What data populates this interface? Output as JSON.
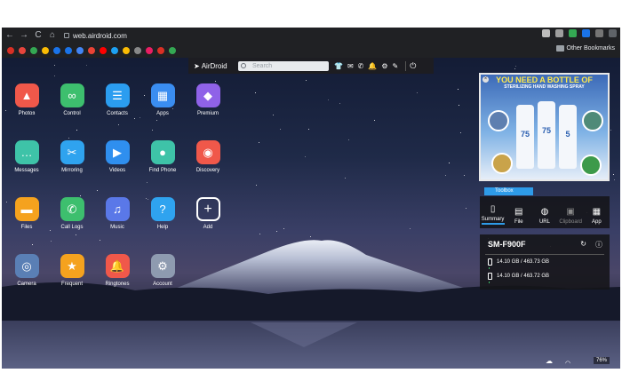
{
  "browser": {
    "url": "web.airdroid.com",
    "other_bookmarks": "Other Bookmarks",
    "nav": {
      "back": "←",
      "forward": "→",
      "reload": "C",
      "home": "⌂"
    },
    "bookmark_colors": [
      "#d93025",
      "#e8453c",
      "#34a853",
      "#fbbc04",
      "#1a73e8",
      "#1a73e8",
      "#4285f4",
      "#ea4335",
      "#ff0000",
      "#1da1f2",
      "#fbbc04",
      "#888888",
      "#e91e63",
      "#d93025",
      "#34a853"
    ],
    "extension_colors": [
      "#bdbdbd",
      "#9e9e9e",
      "#34a853",
      "#1a73e8",
      "#757575",
      "#5f6368"
    ]
  },
  "toolbar": {
    "logo": "AirDroid",
    "search_placeholder": "Search",
    "icons": [
      "shirt-icon",
      "mail-icon",
      "phone-icon",
      "bell-icon",
      "gear-icon",
      "pen-icon"
    ],
    "icon_glyphs": [
      "👕",
      "✉",
      "✆",
      "🔔",
      "⚙",
      "✎"
    ],
    "power": "⏻"
  },
  "apps": [
    {
      "label": "Photos",
      "icon": "photos-icon",
      "glyph": "▲",
      "color": "#f0584a"
    },
    {
      "label": "Control",
      "icon": "binoculars-icon",
      "glyph": "∞",
      "color": "#3dbf6e"
    },
    {
      "label": "Contacts",
      "icon": "contacts-icon",
      "glyph": "☰",
      "color": "#2b9df0"
    },
    {
      "label": "Apps",
      "icon": "apps-grid-icon",
      "glyph": "▦",
      "color": "#3a8df0"
    },
    {
      "label": "Premium",
      "icon": "diamond-icon",
      "glyph": "◆",
      "color": "#8f62e8"
    },
    {
      "label": "Messages",
      "icon": "messages-icon",
      "glyph": "…",
      "color": "#3ec3a8"
    },
    {
      "label": "Mirroring",
      "icon": "scissors-icon",
      "glyph": "✂",
      "color": "#2fa3ef"
    },
    {
      "label": "Videos",
      "icon": "play-icon",
      "glyph": "▶",
      "color": "#2f8fef"
    },
    {
      "label": "Find Phone",
      "icon": "location-pin-icon",
      "glyph": "●",
      "color": "#3ec3a8"
    },
    {
      "label": "Discovery",
      "icon": "discovery-icon",
      "glyph": "◉",
      "color": "#f0584a"
    },
    {
      "label": "Files",
      "icon": "folder-icon",
      "glyph": "▬",
      "color": "#f5a21e"
    },
    {
      "label": "Call Logs",
      "icon": "phone-icon",
      "glyph": "✆",
      "color": "#3dbf6e"
    },
    {
      "label": "Music",
      "icon": "music-icon",
      "glyph": "♫",
      "color": "#5a78e8"
    },
    {
      "label": "Help",
      "icon": "help-icon",
      "glyph": "?",
      "color": "#2fa3ef"
    },
    {
      "label": "Add",
      "icon": "plus-icon",
      "glyph": "+",
      "color": "transparent"
    },
    {
      "label": "Camera",
      "icon": "camera-icon",
      "glyph": "◎",
      "color": "#5a7fb5"
    },
    {
      "label": "Frequent",
      "icon": "frequent-icon",
      "glyph": "★",
      "color": "#f5a21e"
    },
    {
      "label": "Ringtones",
      "icon": "bell-icon",
      "glyph": "🔔",
      "color": "#f0584a"
    },
    {
      "label": "Account",
      "icon": "gear-icon",
      "glyph": "⚙",
      "color": "#8e9bb0"
    }
  ],
  "ad": {
    "title": "YOU NEED A BOTTLE OF",
    "subtitle": "STERILIZING HAND WASHING SPRAY",
    "bottle_labels": [
      "75",
      "75",
      "5"
    ]
  },
  "toolbox": {
    "tab_label": "Toolbox",
    "tools": [
      {
        "label": "Summary",
        "icon": "phone-summary-icon",
        "glyph": "▯",
        "state": "active"
      },
      {
        "label": "File",
        "icon": "file-icon",
        "glyph": "▤",
        "state": "enabled"
      },
      {
        "label": "URL",
        "icon": "globe-icon",
        "glyph": "◍",
        "state": "enabled"
      },
      {
        "label": "Clipboard",
        "icon": "clipboard-icon",
        "glyph": "▣",
        "state": "disabled"
      },
      {
        "label": "App",
        "icon": "app-icon",
        "glyph": "▦",
        "state": "enabled"
      }
    ]
  },
  "device": {
    "name": "SM-F900F",
    "storage": [
      {
        "text": "14.10 GB / 463.73 GB",
        "icon": "phone-storage-icon",
        "used_fraction": 0.03
      },
      {
        "text": "14.10 GB / 463.72 GB",
        "icon": "sd-card-icon",
        "used_fraction": 0.03
      }
    ],
    "refresh_glyph": "↻",
    "info_glyph": "ⓘ"
  },
  "status": {
    "cloud_glyph": "☁",
    "wifi_glyph": "◠",
    "battery": "76%"
  }
}
